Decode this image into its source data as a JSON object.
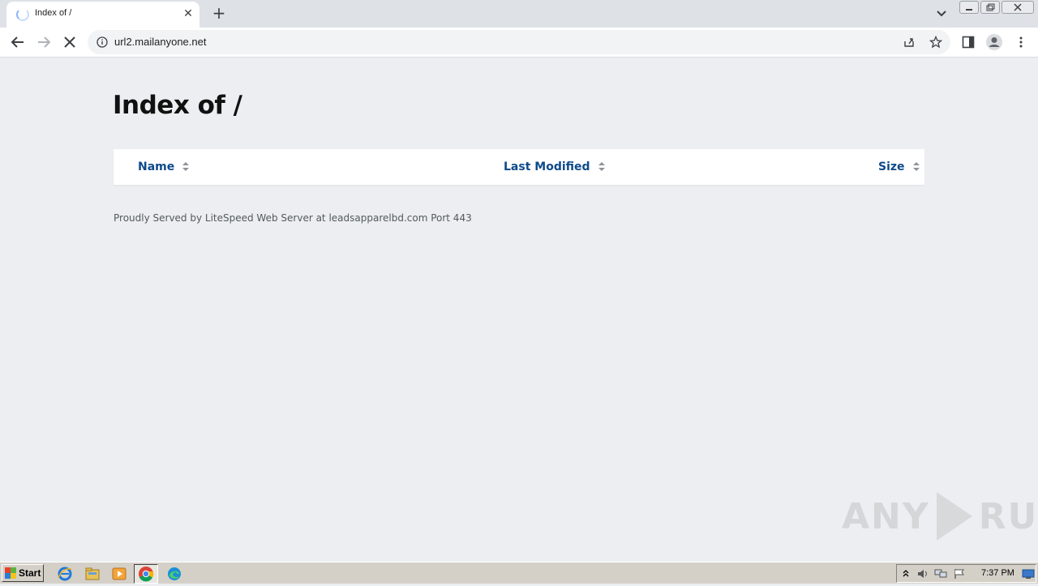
{
  "browser": {
    "tab": {
      "title": "Index of /",
      "close_glyph": "✕"
    },
    "new_tab_glyph": "+",
    "url": "url2.mailanyone.net"
  },
  "page": {
    "heading": "Index of /",
    "columns": [
      "Name",
      "Last Modified",
      "Size"
    ],
    "footer": "Proudly Served by LiteSpeed Web Server at leadsapparelbd.com Port 443"
  },
  "watermark": {
    "left": "ANY",
    "right": "RUN"
  },
  "taskbar": {
    "start_label": "Start",
    "clock": "7:37 PM"
  },
  "colors": {
    "page_bg": "#eceef1",
    "column_link": "#0e4a8a",
    "tab_strip": "#dee1e6"
  }
}
